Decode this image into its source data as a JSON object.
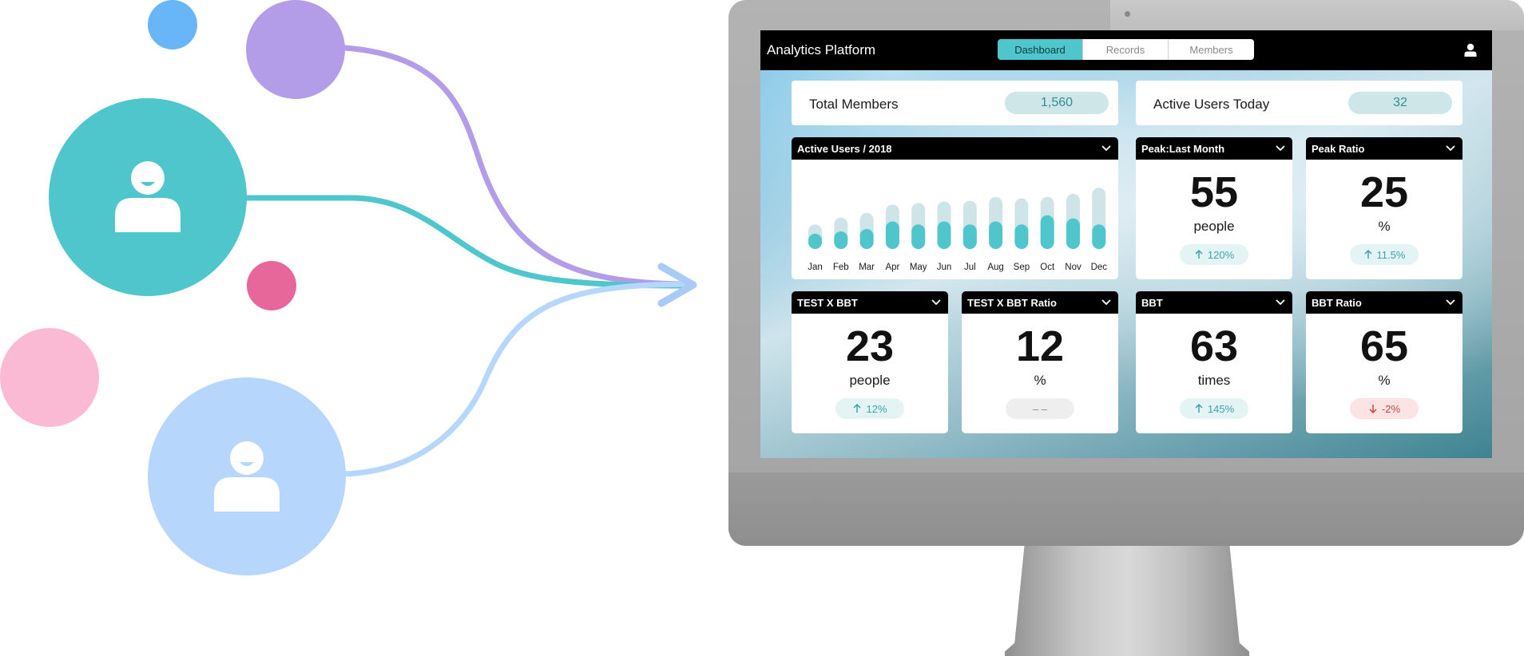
{
  "app": {
    "title": "Analytics Platform",
    "tabs": [
      {
        "label": "Dashboard",
        "active": true
      },
      {
        "label": "Records",
        "active": false
      },
      {
        "label": "Members",
        "active": false
      }
    ],
    "user_icon": "user-icon"
  },
  "summary": {
    "total_members": {
      "label": "Total Members",
      "value": "1,560"
    },
    "active_today": {
      "label": "Active Users Today",
      "value": "32"
    }
  },
  "chart_card": {
    "title": "Active Users / 2018"
  },
  "chart_data": {
    "type": "bar",
    "title": "Active Users / 2018",
    "categories": [
      "Jan",
      "Feb",
      "Mar",
      "Apr",
      "May",
      "Jun",
      "Jul",
      "Aug",
      "Sep",
      "Oct",
      "Nov",
      "Dec"
    ],
    "series": [
      {
        "values": [
          32,
          41,
          47,
          58,
          60,
          62,
          63,
          68,
          66,
          68,
          72,
          80
        ]
      },
      {
        "values": [
          20,
          23,
          26,
          36,
          32,
          36,
          32,
          36,
          32,
          44,
          40,
          32
        ]
      }
    ],
    "colors": [
      "#cfe4e6",
      "#4fc6cc"
    ],
    "grid": false,
    "ylim": [
      0,
      100
    ]
  },
  "stats": {
    "peak_last_month": {
      "title": "Peak:Last Month",
      "value": "55",
      "unit": "people",
      "change": "120%",
      "trend": "up"
    },
    "peak_ratio": {
      "title": "Peak Ratio",
      "value": "25",
      "unit": "%",
      "change": "11.5%",
      "trend": "up"
    },
    "test_x_bbt": {
      "title": "TEST X BBT",
      "value": "23",
      "unit": "people",
      "change": "12%",
      "trend": "up"
    },
    "test_x_bbt_ratio": {
      "title": "TEST X BBT Ratio",
      "value": "12",
      "unit": "%",
      "change": "– –",
      "trend": "neutral"
    },
    "bbt": {
      "title": "BBT",
      "value": "63",
      "unit": "times",
      "change": "145%",
      "trend": "up"
    },
    "bbt_ratio": {
      "title": "BBT Ratio",
      "value": "65",
      "unit": "%",
      "change": "-2%",
      "trend": "down"
    }
  },
  "colors": {
    "accent": "#4fc6cc",
    "up": "#3aa6a8",
    "down": "#c84545",
    "person_teal": "#4fc6cc",
    "person_blue": "#b6d6fb",
    "purple": "#b39de8",
    "pink": "#e8679a",
    "light_pink": "#fbbad3",
    "blue": "#68b6f8"
  }
}
